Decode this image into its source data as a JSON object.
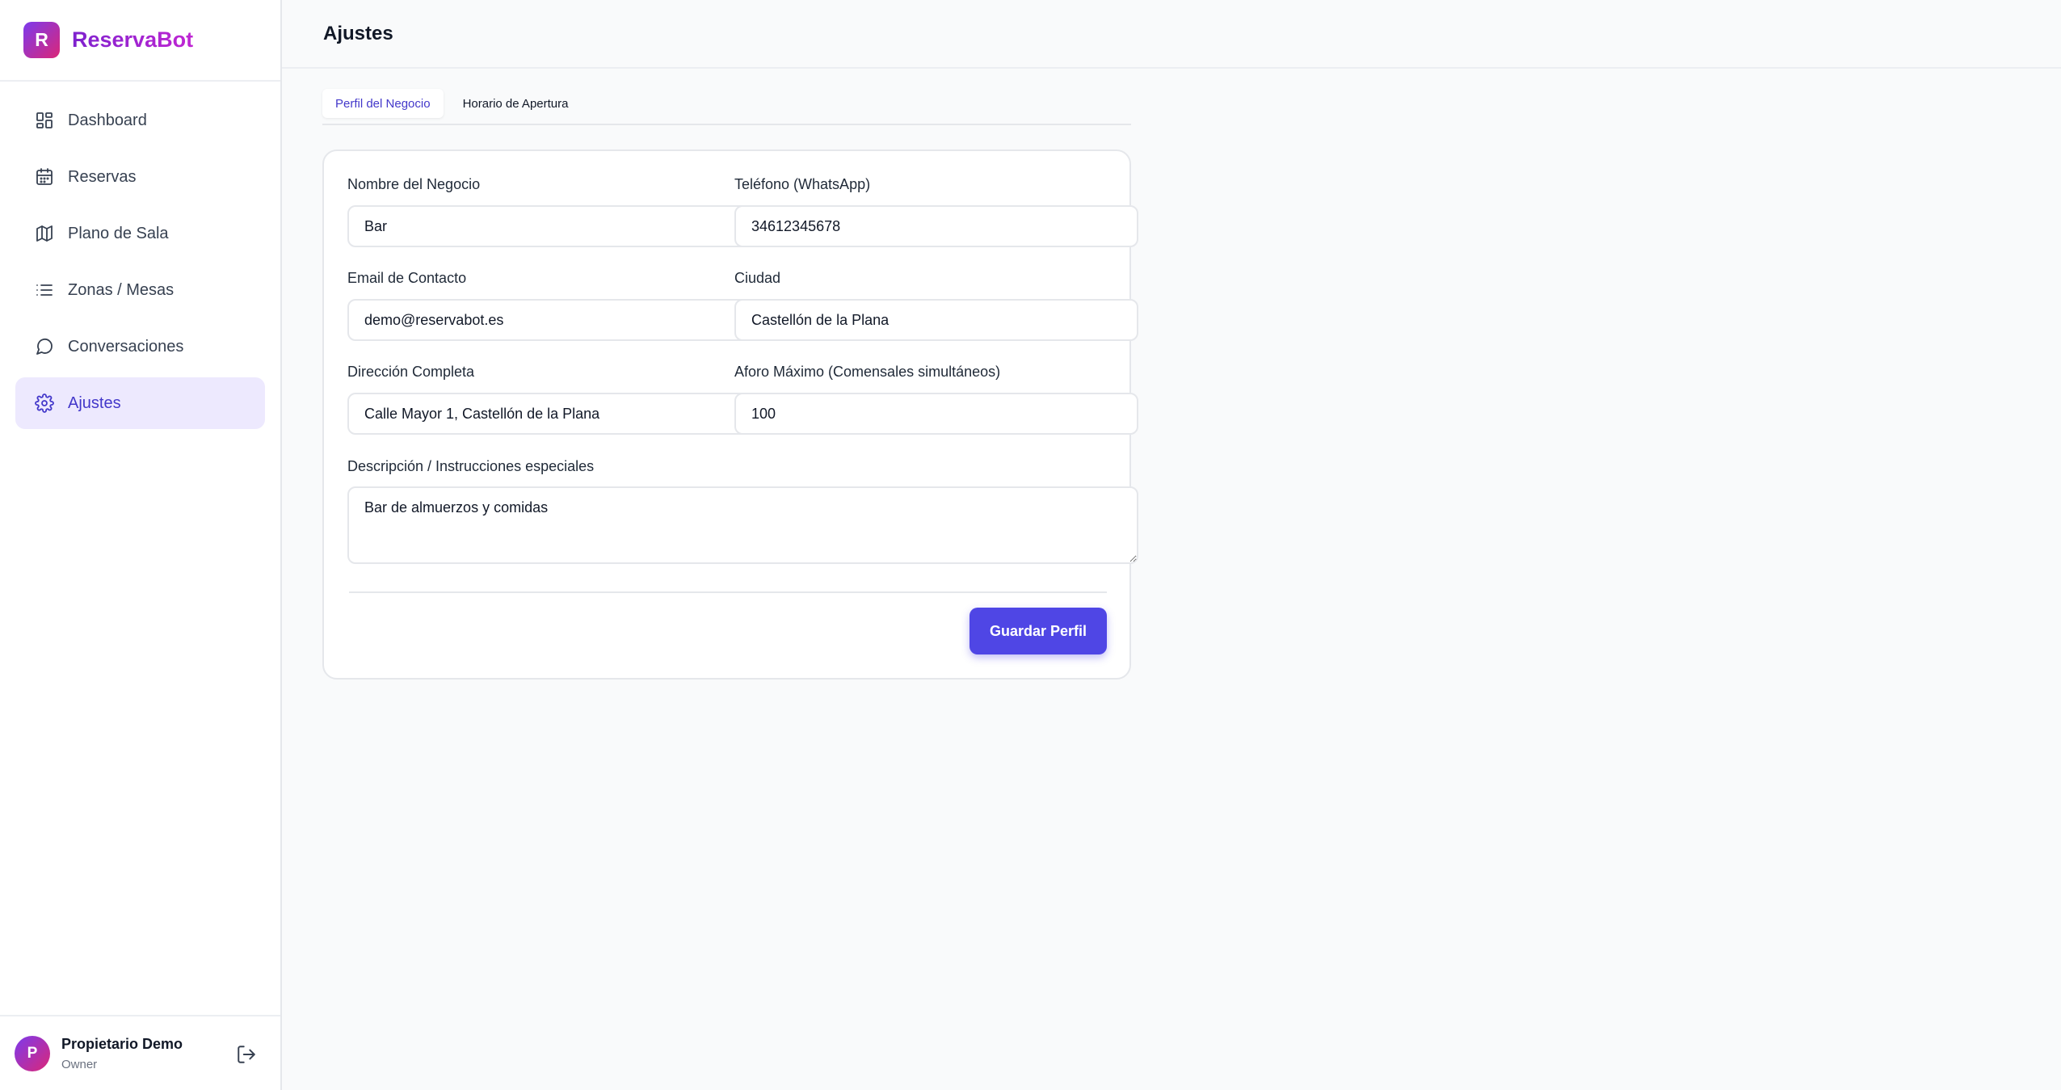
{
  "brand": {
    "logo_letter": "R",
    "name": "ReservaBot"
  },
  "sidebar": {
    "items": [
      {
        "label": "Dashboard",
        "icon": "dashboard-icon"
      },
      {
        "label": "Reservas",
        "icon": "calendar-icon"
      },
      {
        "label": "Plano de Sala",
        "icon": "map-icon"
      },
      {
        "label": "Zonas / Mesas",
        "icon": "list-icon"
      },
      {
        "label": "Conversaciones",
        "icon": "chat-icon"
      },
      {
        "label": "Ajustes",
        "icon": "gear-icon",
        "active": true
      }
    ]
  },
  "user": {
    "initial": "P",
    "name": "Propietario Demo",
    "role": "Owner"
  },
  "header": {
    "title": "Ajustes"
  },
  "tabs": [
    {
      "label": "Perfil del Negocio",
      "active": true
    },
    {
      "label": "Horario de Apertura",
      "active": false
    }
  ],
  "form": {
    "business_name": {
      "label": "Nombre del Negocio",
      "value": "Bar"
    },
    "phone": {
      "label": "Teléfono (WhatsApp)",
      "value": "34612345678"
    },
    "email": {
      "label": "Email de Contacto",
      "value": "demo@reservabot.es"
    },
    "city": {
      "label": "Ciudad",
      "value": "Castellón de la Plana"
    },
    "address": {
      "label": "Dirección Completa",
      "value": "Calle Mayor 1, Castellón de la Plana"
    },
    "capacity": {
      "label": "Aforo Máximo (Comensales simultáneos)",
      "value": "100"
    },
    "description": {
      "label": "Descripción / Instrucciones especiales",
      "value": "Bar de almuerzos y comidas"
    },
    "save_label": "Guardar Perfil"
  },
  "colors": {
    "accent": "#4f46e5",
    "active_nav_bg": "#ede9fe",
    "brand_gradient_start": "#7c3aed",
    "brand_gradient_end": "#db2777"
  }
}
